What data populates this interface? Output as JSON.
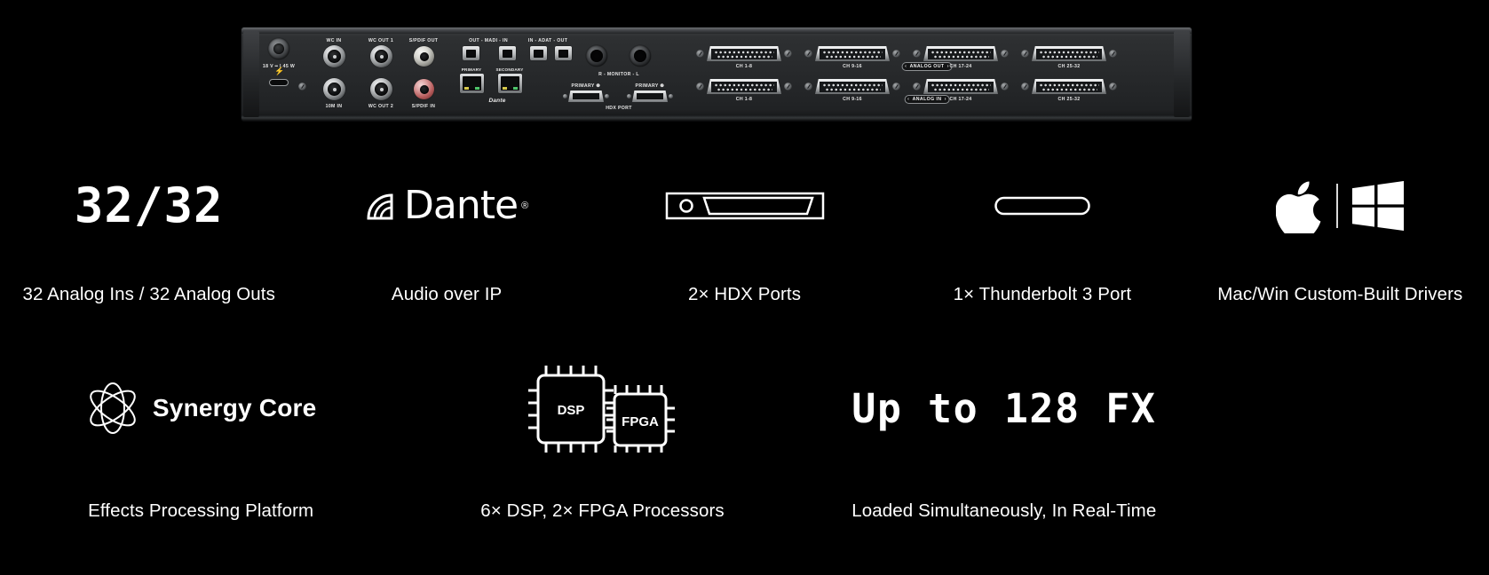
{
  "page": {
    "background": "#000000",
    "text_color": "#ffffff"
  },
  "rack_panel": {
    "name": "rear-panel-photo",
    "labels": {
      "power": "18 V ━ | 45 W",
      "wc_in": "WC IN",
      "wc_out_1": "WC OUT 1",
      "wc_out_2": "WC OUT 2",
      "ten_m_in": "10M IN",
      "spdif_out": "S/PDIF OUT",
      "spdif_in": "S/PDIF IN",
      "madi": "OUT - MADI - IN",
      "adat": "IN - ADAT - OUT",
      "primary": "PRIMARY",
      "secondary": "SECONDARY",
      "dante": "Dante",
      "monitor": "R - MONITOR - L",
      "hdx_primary_1": "PRIMARY ❶",
      "hdx_primary_2": "PRIMARY ❷",
      "hdx_port": "HDX PORT",
      "analog_out": "ANALOG OUT",
      "analog_in": "ANALOG IN",
      "ch_1_8": "CH 1-8",
      "ch_9_16": "CH 9-16",
      "ch_17_24": "CH 17-24",
      "ch_25_32": "CH 25-32"
    }
  },
  "features": {
    "row1": [
      {
        "icon": "numeric-3232-icon",
        "icon_text": "32/32",
        "caption": "32 Analog Ins / 32 Analog Outs"
      },
      {
        "icon": "dante-logo-icon",
        "icon_text": "Dante",
        "registered_mark": "®",
        "caption": "Audio over IP"
      },
      {
        "icon": "hdx-port-connector-icon",
        "caption": "2× HDX Ports"
      },
      {
        "icon": "thunderbolt-port-icon",
        "caption": "1× Thunderbolt 3 Port"
      },
      {
        "icon": "apple-windows-logos-icon",
        "caption": "Mac/Win Custom-Built Drivers"
      }
    ],
    "row2": [
      {
        "icon": "synergy-core-logo-icon",
        "icon_text": "Synergy Core",
        "caption": "Effects Processing Platform"
      },
      {
        "icon": "dsp-fpga-chips-icon",
        "chip_1_label": "DSP",
        "chip_2_label": "FPGA",
        "caption": "6× DSP, 2× FPGA Processors"
      },
      {
        "icon": "up-to-128-fx-icon",
        "icon_text": "Up to 128 FX",
        "caption": "Loaded Simultaneously, In Real-Time"
      }
    ]
  }
}
